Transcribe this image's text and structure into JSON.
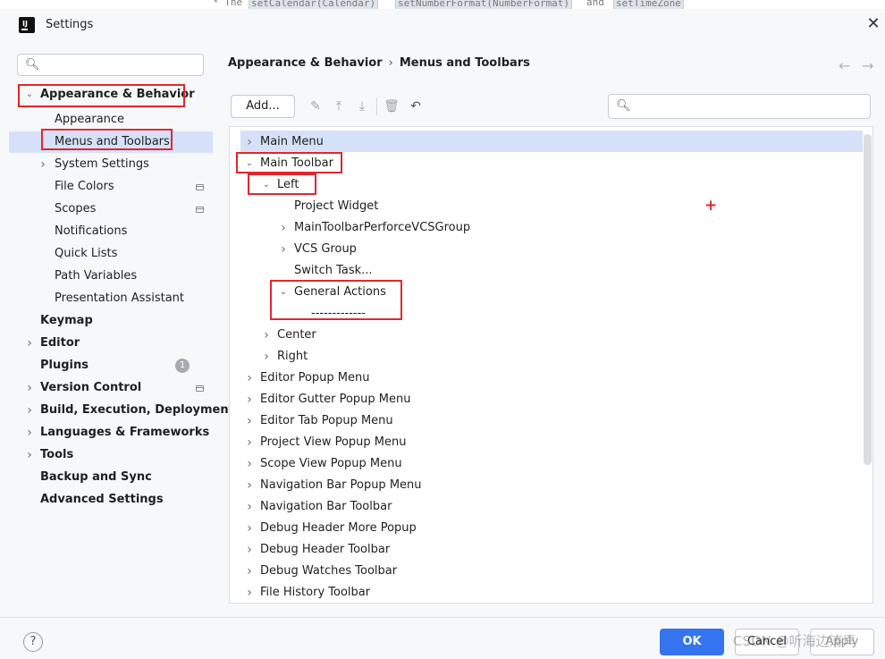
{
  "background_code": {
    "prefix": "* The",
    "chips": [
      "setCalendar(Calendar)",
      "setNumberFormat(NumberFormat)",
      "setTimeZone"
    ],
    "mid_word": "and"
  },
  "window": {
    "title": "Settings",
    "logo_text": "IJ",
    "close_icon": "close-icon"
  },
  "sidebar": {
    "search": {
      "value": "",
      "placeholder": ""
    },
    "items": [
      {
        "label": "Appearance & Behavior",
        "bold": true,
        "expanded": true,
        "marked": true
      },
      {
        "label": "Appearance"
      },
      {
        "label": "Menus and Toolbars",
        "selected": true,
        "marked": true
      },
      {
        "label": "System Settings",
        "expandable": true
      },
      {
        "label": "File Colors",
        "project_icon": true
      },
      {
        "label": "Scopes",
        "project_icon": true
      },
      {
        "label": "Notifications"
      },
      {
        "label": "Quick Lists"
      },
      {
        "label": "Path Variables"
      },
      {
        "label": "Presentation Assistant"
      },
      {
        "label": "Keymap",
        "bold": true
      },
      {
        "label": "Editor",
        "bold": true,
        "expandable": true
      },
      {
        "label": "Plugins",
        "bold": true,
        "badge": "1"
      },
      {
        "label": "Version Control",
        "bold": true,
        "expandable": true,
        "project_icon": true
      },
      {
        "label": "Build, Execution, Deployment",
        "bold": true,
        "expandable": true
      },
      {
        "label": "Languages & Frameworks",
        "bold": true,
        "expandable": true
      },
      {
        "label": "Tools",
        "bold": true,
        "expandable": true
      },
      {
        "label": "Backup and Sync",
        "bold": true
      },
      {
        "label": "Advanced Settings",
        "bold": true
      }
    ]
  },
  "breadcrumb": {
    "parent": "Appearance & Behavior",
    "separator": "›",
    "current": "Menus and Toolbars"
  },
  "toolbar": {
    "add_label": "Add...",
    "icons": [
      "edit-icon",
      "move-up-icon",
      "move-down-icon",
      "delete-icon",
      "restore-icon"
    ],
    "search": {
      "value": "",
      "placeholder": ""
    }
  },
  "action_tree": {
    "items": [
      {
        "label": "Main Menu",
        "level": 0,
        "state": "collapsed",
        "selected": true
      },
      {
        "label": "Main Toolbar",
        "level": 0,
        "state": "expanded",
        "marked": true
      },
      {
        "label": "Left",
        "level": 1,
        "state": "expanded",
        "marked": true
      },
      {
        "label": "Project Widget",
        "level": 2,
        "state": "leaf"
      },
      {
        "label": "MainToolbarPerforceVCSGroup",
        "level": 2,
        "state": "collapsed"
      },
      {
        "label": "VCS Group",
        "level": 2,
        "state": "collapsed"
      },
      {
        "label": "Switch Task...",
        "level": 2,
        "state": "leaf"
      },
      {
        "label": "General Actions",
        "level": 2,
        "state": "expanded",
        "marked": true
      },
      {
        "label": "-------------",
        "level": 3,
        "state": "leaf",
        "marked": true
      },
      {
        "label": "Center",
        "level": 1,
        "state": "collapsed"
      },
      {
        "label": "Right",
        "level": 1,
        "state": "collapsed"
      },
      {
        "label": "Editor Popup Menu",
        "level": 0,
        "state": "collapsed"
      },
      {
        "label": "Editor Gutter Popup Menu",
        "level": 0,
        "state": "collapsed"
      },
      {
        "label": "Editor Tab Popup Menu",
        "level": 0,
        "state": "collapsed"
      },
      {
        "label": "Project View Popup Menu",
        "level": 0,
        "state": "collapsed"
      },
      {
        "label": "Scope View Popup Menu",
        "level": 0,
        "state": "collapsed"
      },
      {
        "label": "Navigation Bar Popup Menu",
        "level": 0,
        "state": "collapsed"
      },
      {
        "label": "Navigation Bar Toolbar",
        "level": 0,
        "state": "collapsed"
      },
      {
        "label": "Debug Header More Popup",
        "level": 0,
        "state": "collapsed"
      },
      {
        "label": "Debug Header Toolbar",
        "level": 0,
        "state": "collapsed"
      },
      {
        "label": "Debug Watches Toolbar",
        "level": 0,
        "state": "collapsed"
      },
      {
        "label": "File History Toolbar",
        "level": 0,
        "state": "collapsed"
      }
    ],
    "annotation_plus": "+"
  },
  "footer": {
    "help": "?",
    "ok": "OK",
    "cancel": "Cancel",
    "apply": "Apply",
    "watermark": "CSDN @听海边涛声"
  },
  "colors": {
    "selection": "#d5e1f8",
    "primary_button": "#3574f0",
    "annotation_red": "#e3262d"
  }
}
